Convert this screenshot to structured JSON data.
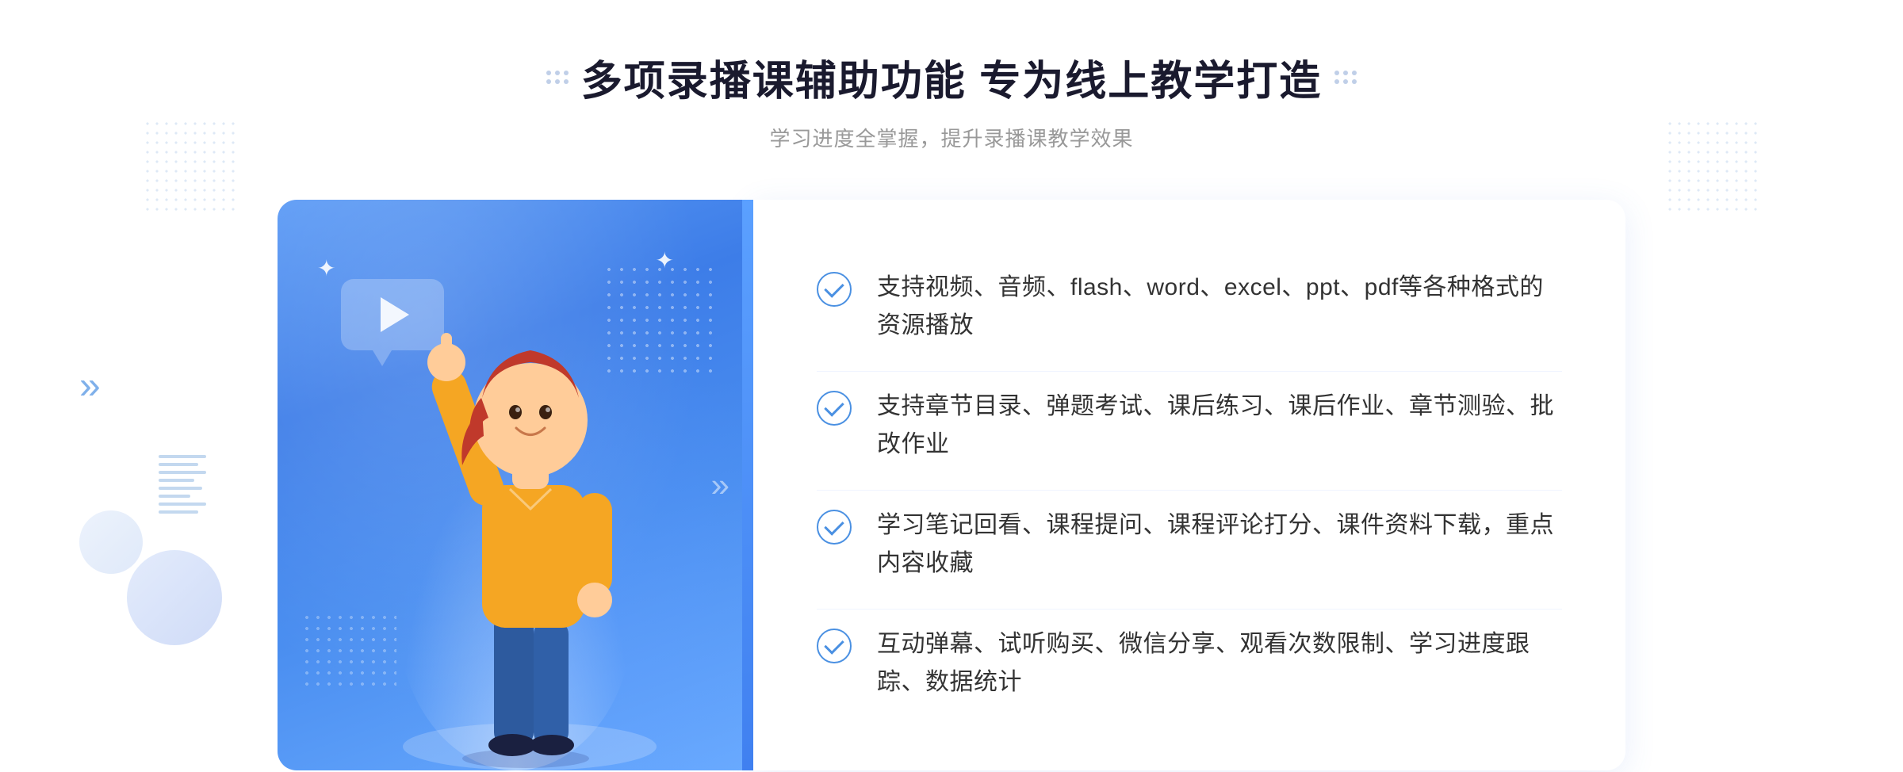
{
  "header": {
    "title": "多项录播课辅助功能 专为线上教学打造",
    "subtitle": "学习进度全掌握，提升录播课教学效果"
  },
  "features": [
    {
      "id": "feature-1",
      "text": "支持视频、音频、flash、word、excel、ppt、pdf等各种格式的资源播放"
    },
    {
      "id": "feature-2",
      "text": "支持章节目录、弹题考试、课后练习、课后作业、章节测验、批改作业"
    },
    {
      "id": "feature-3",
      "text": "学习笔记回看、课程提问、课程评论打分、课件资料下载，重点内容收藏"
    },
    {
      "id": "feature-4",
      "text": "互动弹幕、试听购买、微信分享、观看次数限制、学习进度跟踪、数据统计"
    }
  ],
  "decorations": {
    "chevron": "»",
    "sparkle": "✦"
  }
}
